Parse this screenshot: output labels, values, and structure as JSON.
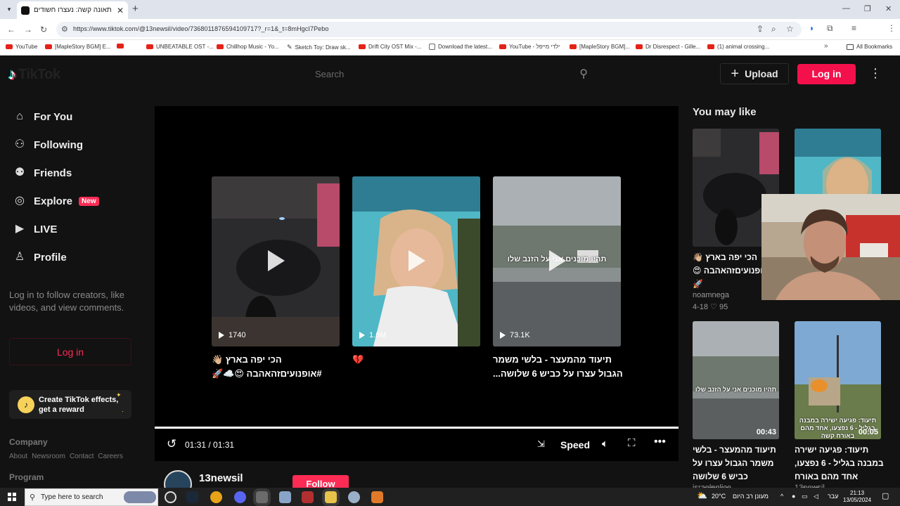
{
  "browser": {
    "tab_title": "יש תאונה קשה: נעצרו חשודים",
    "tab_close": "✕",
    "new_tab": "+",
    "url": "https://www.tiktok.com/@13newsil/video/7368011876594109717?_r=1&_t=8mHgcI7Pebo",
    "bookmarks": [
      {
        "label": "YouTube",
        "icon": "youtube-icon"
      },
      {
        "label": "[MapleStory BGM] E...",
        "icon": "youtube-icon"
      },
      {
        "label": "",
        "icon": "youtube-icon"
      },
      {
        "label": "UNBEATABLE OST -...",
        "icon": "youtube-icon"
      },
      {
        "label": "Chillhop Music - Yo...",
        "icon": "youtube-icon"
      },
      {
        "label": "Sketch Toy: Draw sk...",
        "icon": "sketch-icon"
      },
      {
        "label": "Drift City OST Mix -...",
        "icon": "youtube-icon"
      },
      {
        "label": "Download the latest...",
        "icon": "document-icon"
      },
      {
        "label": "YouTube - ילדי מייפל",
        "icon": "youtube-icon"
      },
      {
        "label": "[MapleStory BGM]...",
        "icon": "youtube-icon"
      },
      {
        "label": "Dr Disrespect - Gille...",
        "icon": "youtube-icon"
      },
      {
        "label": "(1) animal crossing...",
        "icon": "youtube-icon"
      }
    ],
    "all_bookmarks": "All Bookmarks",
    "colors": {
      "tabbar": "#dfe3eb",
      "youtube_red": "#e62117"
    }
  },
  "header": {
    "logo": "TikTok",
    "search_placeholder": "Search",
    "upload_label": "Upload",
    "login_label": "Log in"
  },
  "sidebar": {
    "items": [
      {
        "label": "For You",
        "icon": "home-icon"
      },
      {
        "label": "Following",
        "icon": "following-icon"
      },
      {
        "label": "Friends",
        "icon": "friends-icon"
      },
      {
        "label": "Explore",
        "icon": "compass-icon",
        "badge": "New"
      },
      {
        "label": "LIVE",
        "icon": "live-icon"
      },
      {
        "label": "Profile",
        "icon": "profile-icon"
      }
    ],
    "login_prompt": "Log in to follow creators, like videos, and view comments.",
    "login_button": "Log in",
    "effects_line1": "Create TikTok effects,",
    "effects_line2": "get a reward",
    "company_heading": "Company",
    "company_links": [
      "About",
      "Newsroom",
      "Contact",
      "Careers"
    ],
    "program_heading": "Program"
  },
  "player": {
    "related": [
      {
        "count": "1740",
        "caption": "הכי יפה בארץ 👋🏼 #אופנועיםזהאהבה 😍☁️🚀",
        "overlay": ""
      },
      {
        "count": "1.6M",
        "caption": "💔",
        "overlay": ""
      },
      {
        "count": "73.1K",
        "caption": "תיעוד מהמעצר - בלשי משמר הגבול עצרו על כביש 6 שלושה...",
        "overlay": "תהיו מוכנים אני על הזנב שלו"
      }
    ],
    "time": "01:31 / 01:31",
    "progress": 1.0,
    "speed_label": "Speed",
    "author": "13newsil",
    "follow_label": "Follow"
  },
  "you_may_like": {
    "heading": "You may like",
    "cards": [
      {
        "caption": "הכי יפה בארץ 👋🏼 #אופנועיםזהאהבה 😍 🚀",
        "author": "noamnega",
        "date": "4-18",
        "likes": "95",
        "duration": "0"
      },
      {
        "caption": "",
        "author": "",
        "date": "",
        "likes": "",
        "duration": ""
      },
      {
        "caption": "תיעוד מהמעצר - בלשי משמר הגבול עצרו על כביש 6 שלושה חשודים,...",
        "author": "israelpolice",
        "duration": "00:43",
        "overlay": "תהיו מוכנים אני על הזנב שלו"
      },
      {
        "caption": "תיעוד: פגיעה ישירה במבנה בגליל - 6 נפצעו, אחד מהם באורח קשה...",
        "author": "13newsil",
        "duration": "00:05",
        "overlay": "תיעוד: פגיעה ישירה במבנה בגליל - 6 נפצעו, אחד מהם באורח קשה"
      }
    ]
  },
  "taskbar": {
    "search_placeholder": "Type here to search",
    "weather": "20°C",
    "weather_text": "מעונן רב היום",
    "lang": "עבר",
    "time": "21:13",
    "date": "13/05/2024"
  }
}
